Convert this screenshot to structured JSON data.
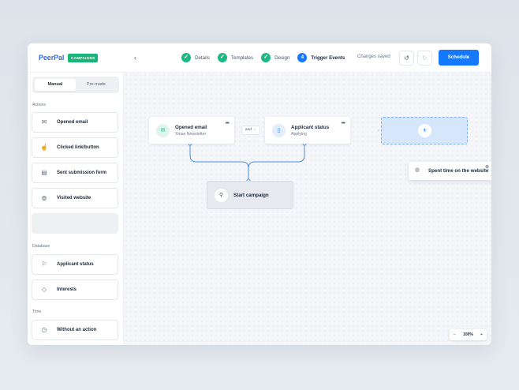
{
  "app": {
    "logo": "PeerPal",
    "badge": "CAMPAIGNS"
  },
  "header": {
    "back_icon": "‹",
    "steps": [
      {
        "label": "Details",
        "state": "done",
        "mark": "✓"
      },
      {
        "label": "Templates",
        "state": "done",
        "mark": "✓"
      },
      {
        "label": "Design",
        "state": "done",
        "mark": "✓"
      },
      {
        "label": "Trigger Events",
        "state": "active",
        "mark": "4"
      }
    ],
    "status": "Changes saved",
    "undo_icon": "↺",
    "redo_icon": "↻",
    "schedule_label": "Schedule"
  },
  "sidebar": {
    "toggle": {
      "selected": "Manual",
      "other": "Pre-made"
    },
    "sections": [
      {
        "title": "Actions"
      },
      {
        "title": "Database"
      },
      {
        "title": "Time"
      }
    ],
    "actions": [
      {
        "label": "Opened email",
        "icon": "✉"
      },
      {
        "label": "Clicked link/button",
        "icon": "☝"
      },
      {
        "label": "Sent submission form",
        "icon": "▤"
      },
      {
        "label": "Visited website",
        "icon": "◍"
      }
    ],
    "database": [
      {
        "label": "Applicant status",
        "icon": "⚐"
      },
      {
        "label": "Interests",
        "icon": "◇"
      }
    ],
    "time": [
      {
        "label": "Without an action",
        "icon": "◷"
      }
    ]
  },
  "canvas": {
    "nodes": {
      "opened_email": {
        "title": "Opened email",
        "subtitle": "Xmas Newsletter",
        "icon": "✉",
        "more": "•••"
      },
      "applicant_status": {
        "title": "Applicant status",
        "subtitle": "Applying",
        "icon": "▯",
        "more": "•••"
      },
      "start": {
        "title": "Start campaign",
        "icon": "⚲"
      },
      "spent_time": {
        "title": "Spent time on the website",
        "icon": "◍",
        "badge_icon": "⊗"
      }
    },
    "connector_label": "and →",
    "add_icon": "+",
    "zoom": {
      "minus": "−",
      "level": "100%",
      "plus": "+"
    }
  }
}
